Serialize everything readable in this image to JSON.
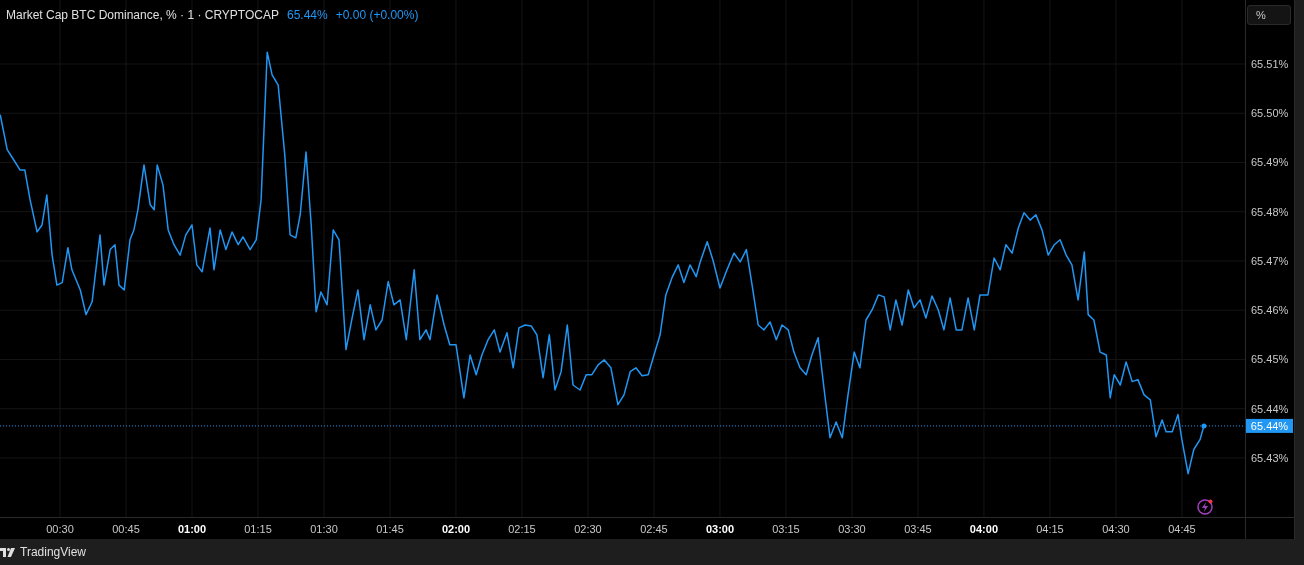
{
  "legend": {
    "title": "Market Cap BTC Dominance, % · 1 · CRYPTOCAP",
    "value": "65.44%",
    "change": "+0.00 (+0.00%)"
  },
  "scale_button": "%",
  "chart_data": {
    "type": "line",
    "x": [
      16.4,
      18.0,
      19.5,
      20.9,
      22.0,
      23.2,
      24.8,
      25.9,
      27.0,
      28.2,
      29.3,
      30.5,
      31.8,
      32.7,
      34.6,
      35.9,
      37.3,
      39.1,
      40.0,
      41.4,
      42.5,
      43.4,
      44.6,
      45.9,
      46.8,
      47.7,
      49.1,
      50.5,
      51.4,
      52.1,
      53.4,
      54.6,
      55.9,
      57.3,
      58.6,
      60.0,
      61.1,
      62.3,
      64.1,
      65.0,
      66.4,
      67.7,
      69.1,
      70.5,
      71.6,
      73.2,
      74.6,
      75.7,
      77.1,
      78.2,
      79.6,
      81.1,
      82.3,
      83.6,
      84.6,
      85.9,
      87.1,
      88.2,
      89.3,
      90.7,
      92.1,
      93.4,
      95.0,
      96.4,
      97.7,
      99.1,
      100.5,
      101.8,
      103.2,
      104.6,
      105.9,
      107.3,
      108.7,
      110.5,
      111.8,
      113.2,
      114.1,
      115.7,
      117.3,
      118.6,
      120.0,
      121.8,
      123.2,
      124.6,
      125.9,
      127.3,
      128.7,
      130.0,
      131.6,
      133.0,
      134.3,
      135.7,
      137.1,
      138.4,
      139.8,
      141.2,
      142.5,
      143.9,
      145.3,
      146.6,
      148.2,
      149.6,
      150.9,
      152.3,
      153.7,
      155.2,
      156.8,
      158.2,
      159.6,
      160.9,
      162.3,
      163.7,
      165.0,
      166.4,
      167.7,
      169.1,
      170.5,
      171.8,
      173.2,
      174.6,
      175.5,
      177.1,
      178.4,
      180.0,
      181.6,
      183.2,
      184.6,
      186.0,
      187.3,
      188.7,
      190.0,
      191.4,
      192.8,
      194.1,
      195.5,
      196.8,
      198.2,
      199.6,
      200.9,
      202.3,
      203.7,
      205.0,
      206.4,
      207.8,
      209.1,
      210.5,
      211.8,
      213.2,
      214.6,
      216.0,
      217.3,
      218.7,
      220.0,
      221.4,
      222.8,
      224.1,
      225.5,
      226.8,
      228.2,
      229.6,
      230.9,
      232.3,
      233.7,
      235.0,
      236.4,
      237.8,
      239.1,
      240.9,
      242.3,
      243.7,
      245.0,
      246.4,
      247.8,
      249.1,
      250.5,
      251.8,
      253.2,
      254.6,
      256.0,
      257.3,
      258.7,
      260.0,
      261.4,
      262.8,
      263.7,
      265.0,
      266.4,
      267.8,
      268.7,
      269.6,
      271.0,
      272.3,
      273.7,
      275.0,
      276.4,
      277.8,
      279.1,
      280.5,
      281.4,
      282.8,
      284.1,
      285.0,
      286.4,
      287.7,
      289.1,
      290.0
    ],
    "grid": true,
    "ref_lines": [
      {
        "axis": "y",
        "value": 65.4365,
        "color": "#2196f3",
        "label": "65.44%"
      }
    ],
    "series": [
      {
        "color": "#2196f3",
        "values": [
          65.4997,
          65.4926,
          65.4905,
          65.4885,
          65.4885,
          65.4824,
          65.4759,
          65.4773,
          65.4834,
          65.4712,
          65.4651,
          65.4656,
          65.4727,
          65.4682,
          65.4641,
          65.4591,
          65.4617,
          65.4753,
          65.4651,
          65.4723,
          65.4733,
          65.4651,
          65.4641,
          65.4743,
          65.4763,
          65.4804,
          65.4895,
          65.4814,
          65.4804,
          65.4895,
          65.4854,
          65.4763,
          65.4733,
          65.4712,
          65.4753,
          65.4773,
          65.4692,
          65.4678,
          65.4767,
          65.4682,
          65.4763,
          65.4723,
          65.4759,
          65.4733,
          65.4749,
          65.4723,
          65.4743,
          65.4824,
          65.5124,
          65.5078,
          65.5057,
          65.4915,
          65.4753,
          65.4747,
          65.4794,
          65.4921,
          65.4773,
          65.4597,
          65.4637,
          65.4611,
          65.4763,
          65.4743,
          65.452,
          65.4584,
          65.4641,
          65.454,
          65.4611,
          65.456,
          65.458,
          65.4658,
          65.4611,
          65.4621,
          65.454,
          65.4682,
          65.454,
          65.456,
          65.454,
          65.4631,
          65.457,
          65.453,
          65.453,
          65.4422,
          65.4509,
          65.4469,
          65.4509,
          65.454,
          65.456,
          65.4515,
          65.4554,
          65.4483,
          65.4564,
          65.457,
          65.4568,
          65.455,
          65.4463,
          65.455,
          65.4438,
          65.4475,
          65.457,
          65.4448,
          65.4438,
          65.4469,
          65.4469,
          65.4489,
          65.4499,
          65.4483,
          65.4408,
          65.4428,
          65.4475,
          65.4483,
          65.4467,
          65.4469,
          65.4509,
          65.455,
          65.4631,
          65.4666,
          65.4692,
          65.4656,
          65.4692,
          65.4668,
          65.4698,
          65.4739,
          65.4702,
          65.4645,
          65.4682,
          65.4716,
          65.4698,
          65.4723,
          65.4651,
          65.457,
          65.456,
          65.4576,
          65.454,
          65.457,
          65.456,
          65.4515,
          65.4483,
          65.4469,
          65.4509,
          65.4544,
          65.4438,
          65.4341,
          65.4373,
          65.4341,
          65.4428,
          65.4515,
          65.4483,
          65.458,
          65.4601,
          65.4631,
          65.4627,
          65.456,
          65.4621,
          65.457,
          65.4641,
          65.4605,
          65.4621,
          65.4584,
          65.4629,
          65.4601,
          65.456,
          65.4625,
          65.456,
          65.456,
          65.4625,
          65.456,
          65.4631,
          65.4631,
          65.4706,
          65.4682,
          65.4733,
          65.4716,
          65.4767,
          65.4798,
          65.4783,
          65.4794,
          65.4763,
          65.4712,
          65.4733,
          65.4743,
          65.4712,
          65.4692,
          65.4621,
          65.4718,
          65.4591,
          65.458,
          65.4515,
          65.4509,
          65.4422,
          65.4469,
          65.4448,
          65.4495,
          65.4455,
          65.4459,
          65.4428,
          65.4418,
          65.4343,
          65.4377,
          65.4353,
          65.4353,
          65.4388,
          65.4337,
          65.4268,
          65.4317,
          65.4337,
          65.4365
        ]
      }
    ],
    "xlim": [
      16.36,
      310.7
    ],
    "ylim": [
      65.418,
      65.523
    ],
    "xticks": [
      {
        "value": 30,
        "label": "00:30"
      },
      {
        "value": 45,
        "label": "00:45"
      },
      {
        "value": 60,
        "label": "01:00"
      },
      {
        "value": 75,
        "label": "01:15"
      },
      {
        "value": 90,
        "label": "01:30"
      },
      {
        "value": 105,
        "label": "01:45"
      },
      {
        "value": 120,
        "label": "02:00"
      },
      {
        "value": 135,
        "label": "02:15"
      },
      {
        "value": 150,
        "label": "02:30"
      },
      {
        "value": 165,
        "label": "02:45"
      },
      {
        "value": 180,
        "label": "03:00"
      },
      {
        "value": 195,
        "label": "03:15"
      },
      {
        "value": 210,
        "label": "03:30"
      },
      {
        "value": 225,
        "label": "03:45"
      },
      {
        "value": 240,
        "label": "04:00"
      },
      {
        "value": 255,
        "label": "04:15"
      },
      {
        "value": 270,
        "label": "04:30"
      },
      {
        "value": 285,
        "label": "04:45"
      }
    ],
    "yticks": [
      {
        "value": 65.43,
        "label": "65.43%"
      },
      {
        "value": 65.44,
        "label": "65.44%"
      },
      {
        "value": 65.45,
        "label": "65.45%"
      },
      {
        "value": 65.46,
        "label": "65.46%"
      },
      {
        "value": 65.47,
        "label": "65.47%"
      },
      {
        "value": 65.48,
        "label": "65.48%"
      },
      {
        "value": 65.49,
        "label": "65.49%"
      },
      {
        "value": 65.5,
        "label": "65.50%"
      },
      {
        "value": 65.51,
        "label": "65.51%"
      }
    ]
  },
  "footer": {
    "brand": "TradingView"
  }
}
